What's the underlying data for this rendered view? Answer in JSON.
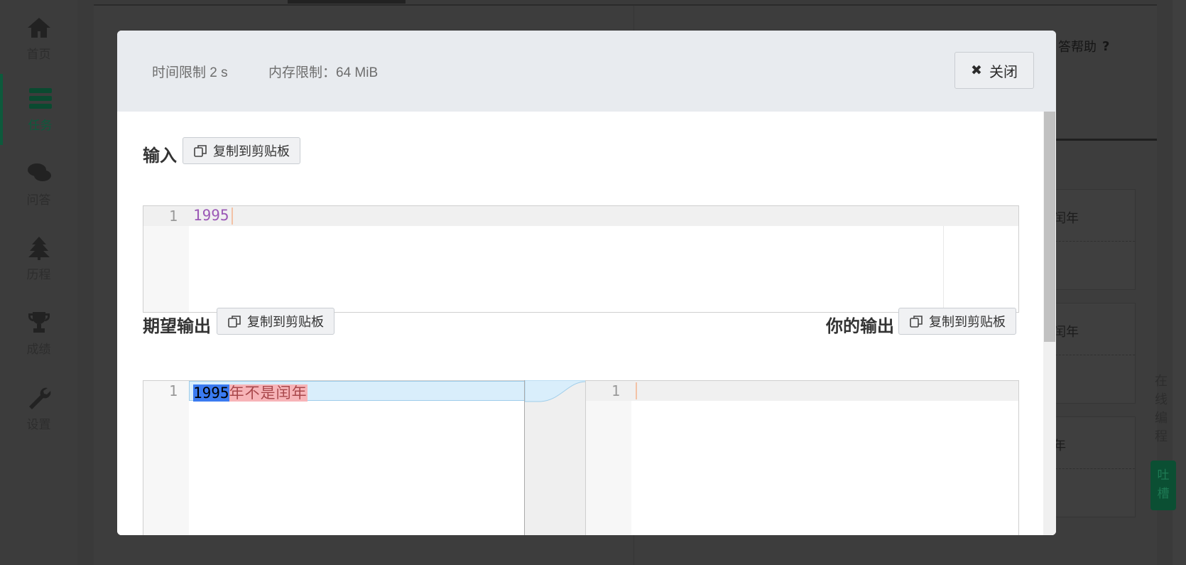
{
  "sidebar": {
    "items": [
      {
        "label": "首页",
        "icon": "home-icon"
      },
      {
        "label": "任务",
        "icon": "tasks-icon",
        "active": true
      },
      {
        "label": "问答",
        "icon": "comments-icon"
      },
      {
        "label": "历程",
        "icon": "tree-icon"
      },
      {
        "label": "成绩",
        "icon": "trophy-icon"
      },
      {
        "label": "设置",
        "icon": "wrench-icon"
      }
    ]
  },
  "background": {
    "help_label": "答帮助",
    "cards": [
      "闰年",
      "闰年",
      "年"
    ],
    "vertical_label": [
      "在",
      "线",
      "编",
      "程"
    ],
    "green_label": [
      "吐",
      "槽"
    ]
  },
  "modal": {
    "time_limit": "时间限制 2 s",
    "memory_limit": "内存限制：64 MiB",
    "close_label": "关闭",
    "input_title": "输入",
    "expected_title": "期望输出",
    "your_output_title": "你的输出",
    "copy_label": "复制到剪贴板",
    "input_editor": {
      "line_numbers": [
        "1"
      ],
      "lines": [
        "1995"
      ]
    },
    "expected_editor": {
      "line_numbers": [
        "1"
      ],
      "selected_text": "1995",
      "diff_text": "年不是闰年"
    },
    "output_editor": {
      "line_numbers": [
        "1"
      ],
      "lines": [
        ""
      ]
    }
  },
  "colors": {
    "accent_green": "#0d5a3c",
    "input_text": "#9b59b6",
    "diff_bg": "#d9eefb",
    "diff_del": "#f7b4b8"
  }
}
